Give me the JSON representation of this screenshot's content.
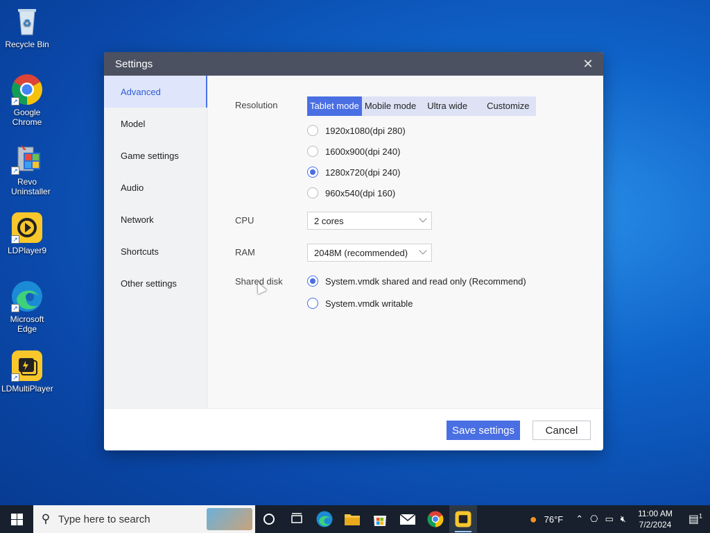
{
  "desktop": {
    "icons": [
      {
        "label": "Recycle Bin",
        "icon": "recycle-bin-icon"
      },
      {
        "label": "Google Chrome",
        "icon": "chrome-icon"
      },
      {
        "label": "Revo Uninstaller",
        "icon": "revo-uninstaller-icon"
      },
      {
        "label": "LDPlayer9",
        "icon": "ldplayer-icon"
      },
      {
        "label": "Microsoft Edge",
        "icon": "edge-icon"
      },
      {
        "label": "LDMultiPlayer",
        "icon": "ldmultiplayer-icon"
      }
    ]
  },
  "window": {
    "title": "Settings",
    "close_glyph": "✕"
  },
  "sidebar": {
    "items": [
      {
        "label": "Advanced",
        "active": true
      },
      {
        "label": "Model"
      },
      {
        "label": "Game settings"
      },
      {
        "label": "Audio"
      },
      {
        "label": "Network"
      },
      {
        "label": "Shortcuts"
      },
      {
        "label": "Other settings"
      }
    ]
  },
  "resolution": {
    "label": "Resolution",
    "tabs": [
      "Tablet mode",
      "Mobile mode",
      "Ultra wide",
      "Customize"
    ],
    "active_tab": "Tablet mode",
    "options": [
      "1920x1080(dpi 280)",
      "1600x900(dpi 240)",
      "1280x720(dpi 240)",
      "960x540(dpi 160)"
    ],
    "selected": "1280x720(dpi 240)"
  },
  "cpu": {
    "label": "CPU",
    "value": "2 cores"
  },
  "ram": {
    "label": "RAM",
    "value": "2048M (recommended)"
  },
  "shared_disk": {
    "label": "Shared disk",
    "options": [
      "System.vmdk shared and read only (Recommend)",
      "System.vmdk writable"
    ],
    "selected": "System.vmdk shared and read only (Recommend)"
  },
  "footer": {
    "save_label": "Save settings",
    "cancel_label": "Cancel"
  },
  "taskbar": {
    "search_placeholder": "Type here to search",
    "weather": "76°F",
    "time": "11:00 AM",
    "date": "7/2/2024",
    "notification_count": "1"
  },
  "colors": {
    "accent": "#4a6fe3",
    "titlebar": "#4b5160",
    "taskbar": "#17202c"
  }
}
